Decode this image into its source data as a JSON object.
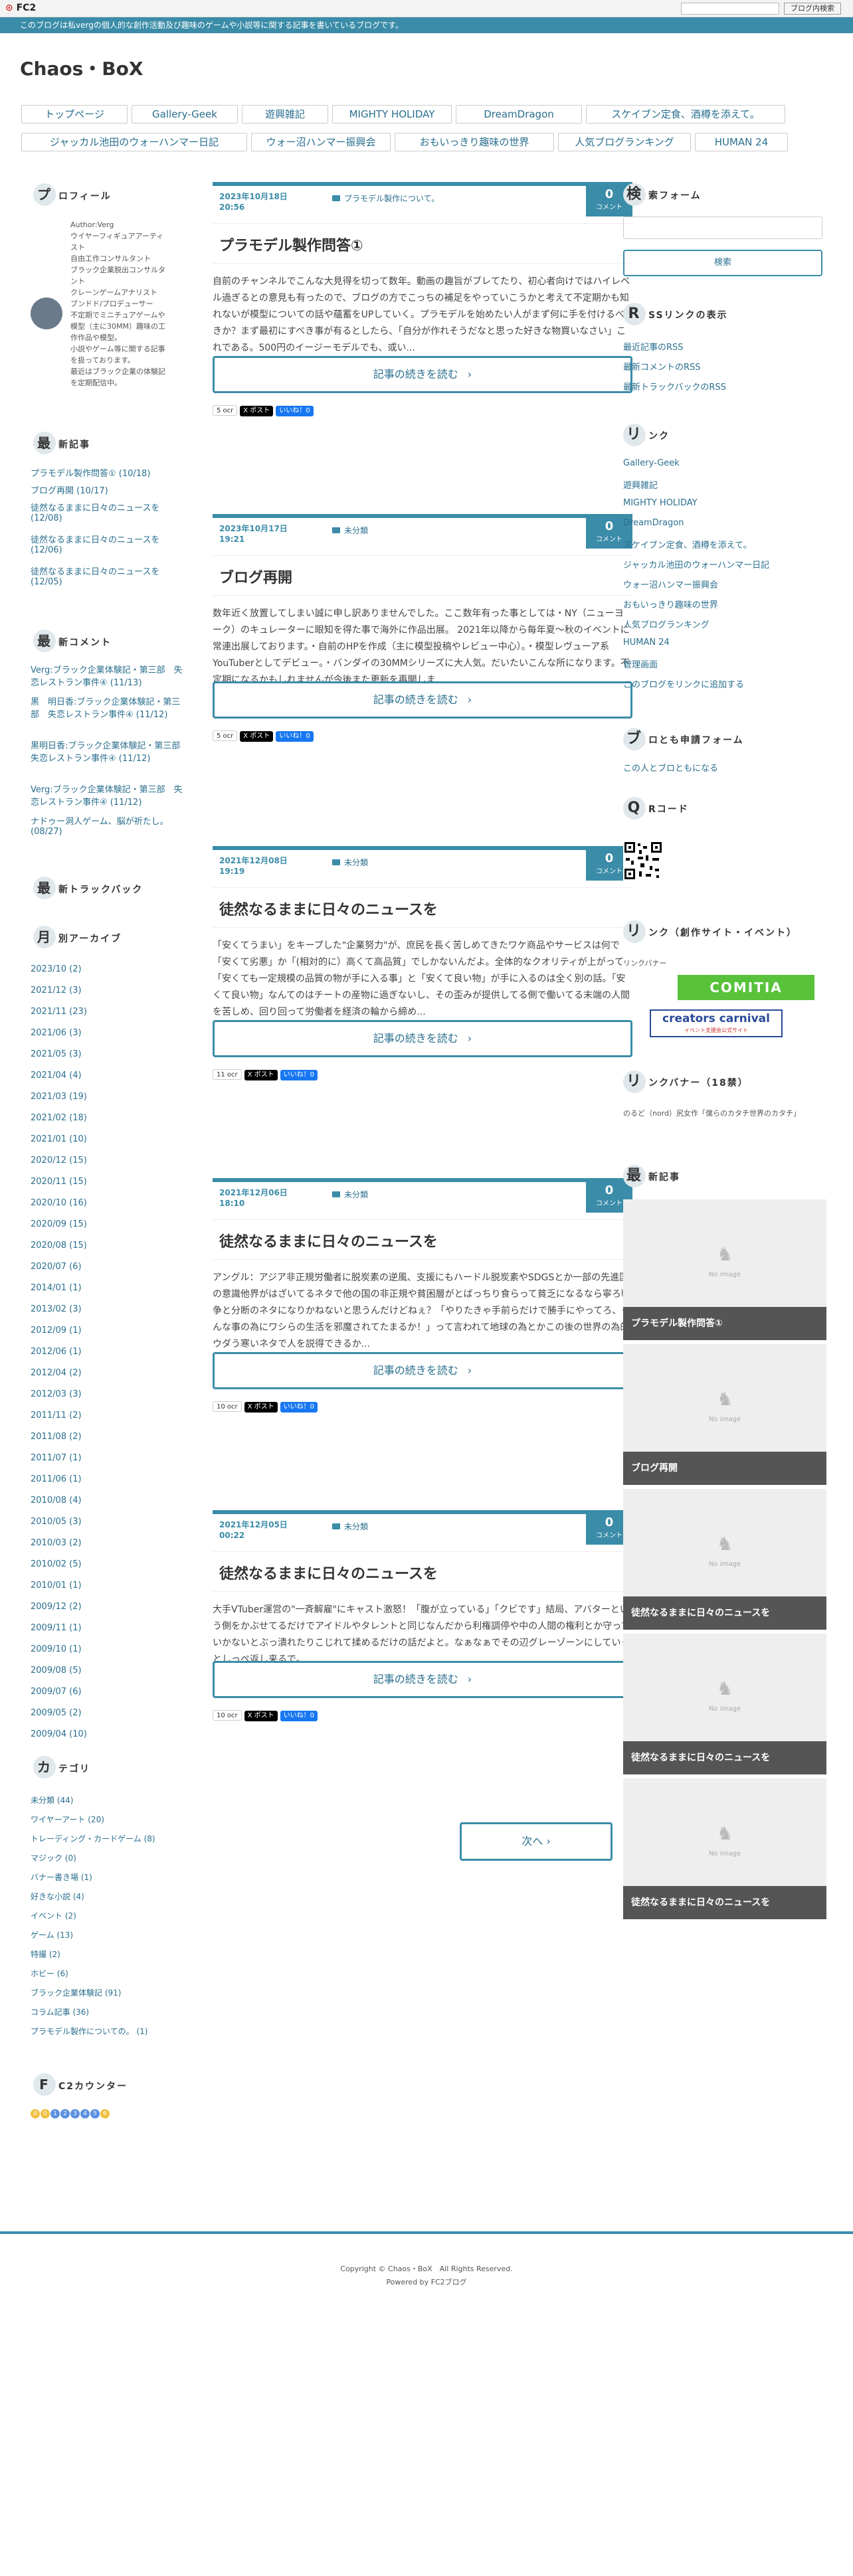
{
  "fc2bar": {
    "logo": "FC2",
    "search_button": "ブログ内検索"
  },
  "description": "このブログは私vergの個人的な創作活動及び趣味のゲームや小説等に関する記事を書いているブログです。",
  "site_title": "Chaos・BoX",
  "nav": [
    {
      "label": "トップページ"
    },
    {
      "label": "Gallery-Geek"
    },
    {
      "label": "遊興雑記"
    },
    {
      "label": "MIGHTY HOLIDAY"
    },
    {
      "label": "DreamDragon"
    },
    {
      "label": "スケイブン定食、酒樽を添えて。"
    },
    {
      "label": "ジャッカル池田のウォーハンマー日記"
    },
    {
      "label": "ウォー沼ハンマー振興会"
    },
    {
      "label": "おもいっきり趣味の世界"
    },
    {
      "label": "人気ブログランキング"
    },
    {
      "label": "HUMAN 24"
    }
  ],
  "profile": {
    "title_big": "プ",
    "title_rest": "ロフィール",
    "lines": [
      "Author:Verg",
      "ウイヤーフィギュアアーティ",
      "スト",
      "自由工作コンサルタント",
      "ブラック企業脱出コンサルタ",
      "ント",
      "クレーンゲームアナリスト",
      "ブンドド/プロデューサー",
      "不定期でミニチュアゲームや",
      "模型（主に30MM）趣味の工",
      "作作品や模型。",
      "小説やゲーム等に関する記事",
      "を扱っております。",
      "最近はブラック企業の体験記",
      "を定期配信中。"
    ]
  },
  "recent_entries": {
    "title_big": "最",
    "title_rest": "新記事",
    "items": [
      "プラモデル製作問答① (10/18)",
      "ブログ再開 (10/17)",
      "徒然なるままに日々のニュースを (12/08)",
      "徒然なるままに日々のニュースを (12/06)",
      "徒然なるままに日々のニュースを (12/05)"
    ]
  },
  "recent_comments": {
    "title_big": "最",
    "title_rest": "新コメント",
    "items": [
      "Verg:ブラック企業体験記・第三部　失恋レストラン事件④ (11/13)",
      "黒　明日香:ブラック企業体験記・第三部　失恋レストラン事件④ (11/12)",
      "黒明日香:ブラック企業体験記・第三部　失恋レストラン事件④ (11/12)",
      "Verg:ブラック企業体験記・第三部　失恋レストラン事件④ (11/12)",
      "ナドゥー洞人ゲーム、脳が祈たし。(08/27)"
    ]
  },
  "trackback": {
    "title_big": "最",
    "title_rest": "新トラックバック"
  },
  "archive": {
    "title_big": "月",
    "title_rest": "別アーカイブ",
    "items": [
      "2023/10 (2)",
      "2021/12 (3)",
      "2021/11 (23)",
      "2021/06 (3)",
      "2021/05 (3)",
      "2021/04 (4)",
      "2021/03 (19)",
      "2021/02 (18)",
      "2021/01 (10)",
      "2020/12 (15)",
      "2020/11 (15)",
      "2020/10 (16)",
      "2020/09 (15)",
      "2020/08 (15)",
      "2020/07 (6)",
      "2014/01 (1)",
      "2013/02 (3)",
      "2012/09 (1)",
      "2012/06 (1)",
      "2012/04 (2)",
      "2012/03 (3)",
      "2011/11 (2)",
      "2011/08 (2)",
      "2011/07 (1)",
      "2011/06 (1)",
      "2010/08 (4)",
      "2010/05 (3)",
      "2010/03 (2)",
      "2010/02 (5)",
      "2010/01 (1)",
      "2009/12 (2)",
      "2009/11 (1)",
      "2009/10 (1)",
      "2009/08 (5)",
      "2009/07 (6)",
      "2009/05 (2)",
      "2009/04 (10)"
    ]
  },
  "categories": {
    "title_big": "カ",
    "title_rest": "テゴリ",
    "items": [
      "未分類 (44)",
      "ワイヤーアート (20)",
      "トレーディング・カードゲーム (8)",
      "マジック (0)",
      "バナー書き場 (1)",
      "好きな小説 (4)",
      "イベント (2)",
      "ゲーム (13)",
      "特撮 (2)",
      "ホビー (6)",
      "ブラック企業体験記 (91)",
      "コラム記事 (36)",
      "プラモデル製作についての。 (1)"
    ]
  },
  "counter": {
    "title_big": "F",
    "title_rest": "C2カウンター",
    "digits": [
      "0",
      "0",
      "1",
      "2",
      "3",
      "4",
      "5",
      "6"
    ]
  },
  "entries": [
    {
      "date": "2023年10月18日 20:56",
      "category": "プラモデル製作について。",
      "comments": "0",
      "comment_label": "コメント",
      "title": "プラモデル製作問答①",
      "body": "自前のチャンネルでこんな大見得を切って数年。動画の趣旨がブレてたり、初心者向けではハイレベル過ぎるとの意見も有ったので、ブログの方でこっちの補足をやっていこうかと考えて不定期かも知れないが模型についての話や蘊蓄をUPしていく。プラモデルを始めたい人がまず何に手を付けるべきか？まず最初にすべき事が有るとしたら、「自分が作れそうだなと思った好きな物買いなさい」これである。500円のイージーモデルでも、或い...",
      "readmore": "記事の続きを読む",
      "hb": "5 ocr",
      "x": "X ポスト",
      "fb": "いいね！0"
    },
    {
      "date": "2023年10月17日 19:21",
      "category": "未分類",
      "comments": "0",
      "comment_label": "コメント",
      "title": "ブログ再開",
      "body": "数年近く放置してしまい誠に申し訳ありませんでした。ここ数年有った事としては・NY（ニューヨーク）のキュレーターに眼知を得た事で海外に作品出展。 2021年以降から毎年夏〜秋のイベントに常連出展しております。・自前のHPを作成（主に模型投稿やレビュー中心）。・模型レヴューア系YouTuberとしてデビュー。・バンダイの30MMシリーズに大人気。だいたいこんな所になります。不定期になるかもしれませんが今後また更新を再開しま...",
      "readmore": "記事の続きを読む",
      "hb": "5 ocr",
      "x": "X ポスト",
      "fb": "いいね！0"
    },
    {
      "date": "2021年12月08日 19:19",
      "category": "未分類",
      "comments": "0",
      "comment_label": "コメント",
      "title": "徒然なるままに日々のニュースを",
      "body": "「安くてうまい」をキープした\"企業努力\"が、庶民を長く苦しめてきたワケ商品やサービスは何で「安くて劣悪」か「(相対的に）高くて高品質」でしかないんだよ。全体的なクオリティが上がって「安くても一定規模の品質の物が手に入る事」と「安くて良い物」が手に入るのは全く別の話。「安くて良い物」なんてのはチートの産物に過ぎないし、その歪みが提供してる側で働いてる末端の人間を苦しめ、回り回って労働者を経済の輪から締め...",
      "readmore": "記事の続きを読む",
      "hb": "11 ocr",
      "x": "X ポスト",
      "fb": "いいね！0"
    },
    {
      "date": "2021年12月06日 18:10",
      "category": "未分類",
      "comments": "0",
      "comment_label": "コメント",
      "title": "徒然なるままに日々のニュースを",
      "body": "アングル：アジア非正規労働者に脱炭素の逆風、支援にもハードル脱炭素やSDGSとか一部の先進国の意識他界がはざいてるネタで他の国の非正規や貧困層がとばっちり食らって貧乏になるなら寧ろ戦争と分断のネタになりかねないと思うんだけどねぇ？「やりたきゃ手前らだけで勝手にやってろ、そんな事の為にワシらの生活を邪魔されてたまるか！」って言われて地球の為とかこの後の世界の為的ウダう寒いネタで人を説得できるか...",
      "readmore": "記事の続きを読む",
      "hb": "10 ocr",
      "x": "X ポスト",
      "fb": "いいね！0"
    },
    {
      "date": "2021年12月05日 00:22",
      "category": "未分類",
      "comments": "0",
      "comment_label": "コメント",
      "title": "徒然なるままに日々のニュースを",
      "body": "大手VTuber運営の\"一斉解雇\"にキャスト激怒！「腹が立っている」「クビです」結局、アバターという側をかぶせてるだけでアイドルやタレントと同じなんだから利権調停や中の人間の権利とか守っていかないとぶっ潰れたりこじれて揉めるだけの話だよと。なぁなぁでその辺グレーゾーンにしていくとしっぺ返し来るで。...",
      "readmore": "記事の続きを読む",
      "hb": "10 ocr",
      "x": "X ポスト",
      "fb": "いいね！0"
    }
  ],
  "next_button": "次へ",
  "search_form": {
    "title_big": "検",
    "title_rest": "索フォーム",
    "button": "検索"
  },
  "rss": {
    "title_big": "R",
    "title_rest": "SSリンクの表示",
    "items": [
      "最近記事のRSS",
      "最新コメントのRSS",
      "最新トラックバックのRSS"
    ]
  },
  "links": {
    "title_big": "リ",
    "title_rest": "ンク",
    "items": [
      "Gallery-Geek",
      "遊興雑記",
      "MIGHTY HOLIDAY",
      "DreamDragon",
      "スケイブン定食、酒樽を添えて。",
      "ジャッカル池田のウォーハンマー日記",
      "ウォー沼ハンマー振興会",
      "おもいっきり趣味の世界",
      "人気ブログランキング",
      "HUMAN 24",
      "管理画面",
      "このブログをリンクに追加する"
    ]
  },
  "friend_form": {
    "title_big": "ブ",
    "title_rest": "ロとも申請フォーム",
    "link": "この人とブロともになる"
  },
  "qr": {
    "title_big": "Q",
    "title_rest": "Rコード"
  },
  "creative_links": {
    "title_big": "リ",
    "title_rest": "ンク（創作サイト・イベント）",
    "sub": "リンクバナー",
    "comitia": "COMITIA",
    "creators": "creators carnival",
    "creators_sub": "イベント支援会公式サイト"
  },
  "link_banner": {
    "title_big": "リ",
    "title_rest": "ンクバナー（18禁）",
    "text": "のるど（nord）尻女作「僕らのカタチ世界のカタチ」"
  },
  "latest_articles": {
    "title_big": "最",
    "title_rest": "新記事",
    "no_image": "No image",
    "items": [
      "プラモデル製作問答①",
      "ブログ再開",
      "徒然なるままに日々のニュースを",
      "徒然なるままに日々のニュースを",
      "徒然なるままに日々のニュースを"
    ]
  },
  "footer": {
    "copyright": "Copyright © Chaos・BoX　All Rights Reserved.",
    "powered": "Powered by FC2ブログ"
  },
  "colors": {
    "accent": "#3a8ca8",
    "link": "#2a6f8e"
  }
}
